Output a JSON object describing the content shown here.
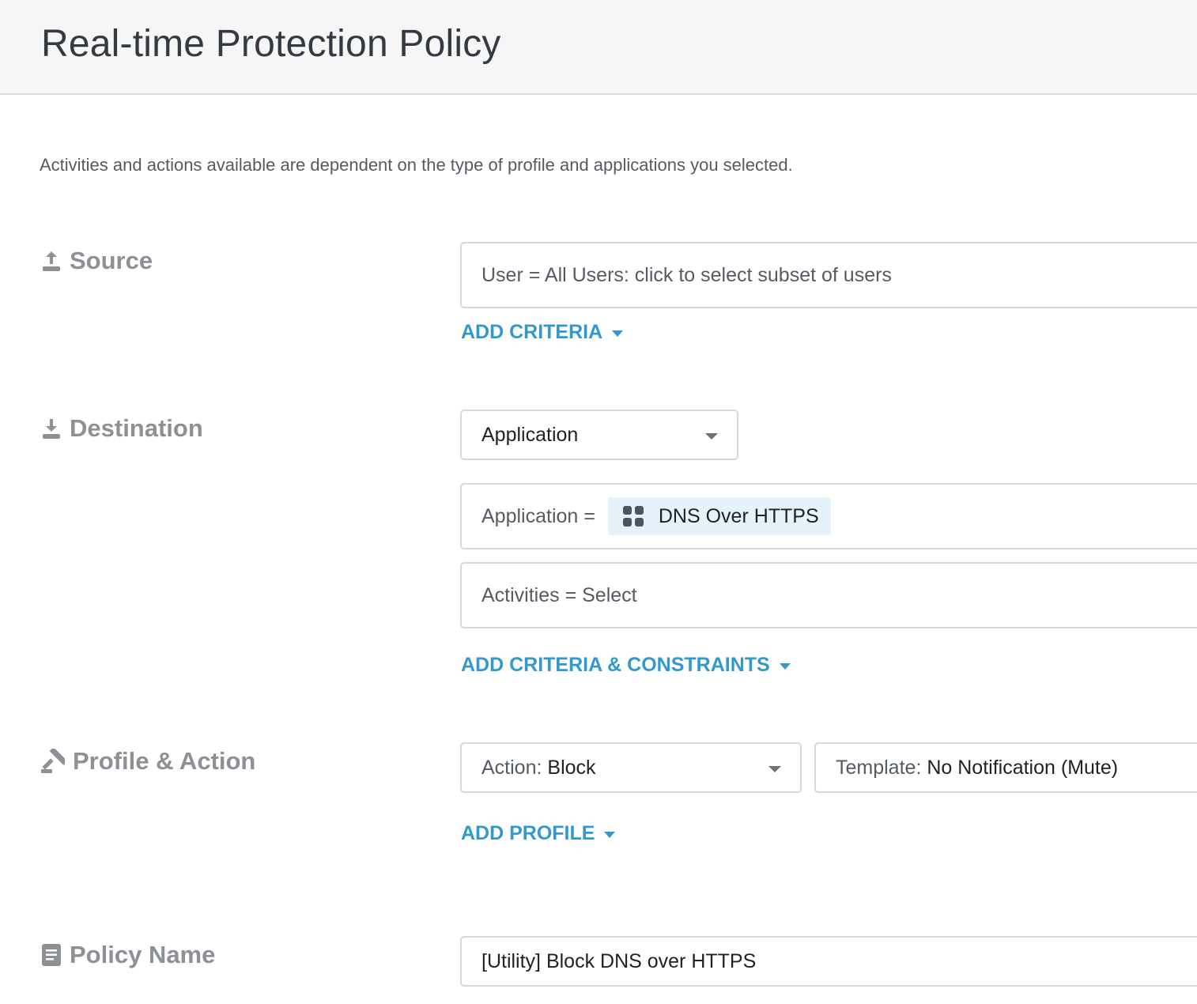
{
  "header": {
    "title": "Real-time Protection Policy"
  },
  "description": "Activities and actions available are dependent on the type of profile and applications you selected.",
  "source": {
    "label": "Source",
    "icon": "upload-icon",
    "user_field": "User = All Users: click to select subset of users",
    "add_criteria": "ADD CRITERIA"
  },
  "destination": {
    "label": "Destination",
    "icon": "download-icon",
    "type_select": "Application",
    "application_prefix": "Application =",
    "application_chip": "DNS Over HTTPS",
    "application_chip_icon": "app-grid-icon",
    "activities_field": "Activities = Select",
    "add_criteria_constraints": "ADD CRITERIA & CONSTRAINTS"
  },
  "profile_action": {
    "label": "Profile & Action",
    "icon": "gavel-icon",
    "action_label": "Action:",
    "action_value": "Block",
    "template_label": "Template:",
    "template_value": "No Notification (Mute)",
    "add_profile": "ADD PROFILE"
  },
  "policy_name": {
    "label": "Policy Name",
    "icon": "document-icon",
    "value": "[Utility] Block DNS over HTTPS"
  },
  "colors": {
    "link": "#3399cc",
    "label": "#8d9095",
    "chip_bg": "#e4f3fa",
    "header_bg": "#f6f6f6"
  }
}
